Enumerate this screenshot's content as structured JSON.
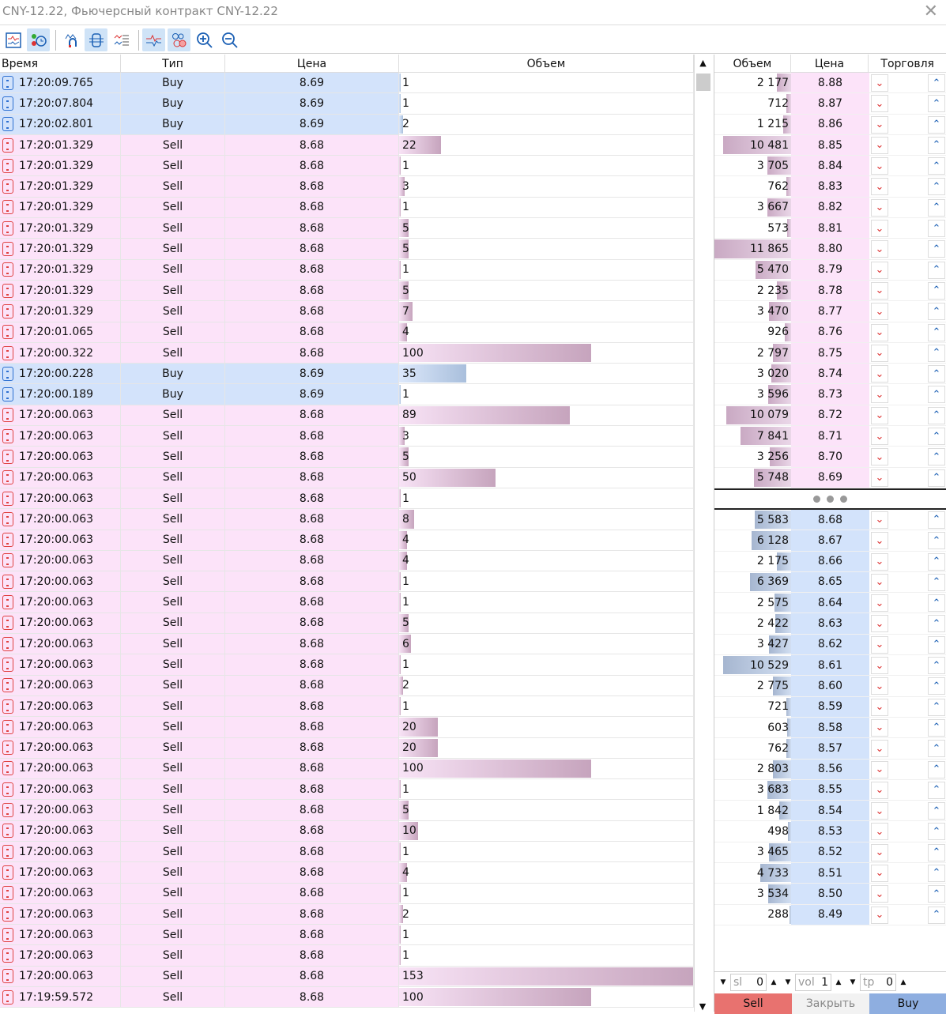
{
  "window": {
    "title": "CNY-12.22, Фьючерсный контракт CNY-12.22"
  },
  "toolbar": [
    "chart-icon",
    "ticks-time-icon",
    "undo-magnet-icon",
    "fit-icon",
    "list-icon",
    "trend-icon",
    "bubbles-icon",
    "zoom-in-icon",
    "zoom-out-icon"
  ],
  "trades": {
    "headers": {
      "time": "Время",
      "type": "Тип",
      "price": "Цена",
      "volume": "Объем"
    },
    "rows": [
      [
        "17:20:09.765",
        "Buy",
        "8.69",
        "1"
      ],
      [
        "17:20:07.804",
        "Buy",
        "8.69",
        "1"
      ],
      [
        "17:20:02.801",
        "Buy",
        "8.69",
        "2"
      ],
      [
        "17:20:01.329",
        "Sell",
        "8.68",
        "22"
      ],
      [
        "17:20:01.329",
        "Sell",
        "8.68",
        "1"
      ],
      [
        "17:20:01.329",
        "Sell",
        "8.68",
        "3"
      ],
      [
        "17:20:01.329",
        "Sell",
        "8.68",
        "1"
      ],
      [
        "17:20:01.329",
        "Sell",
        "8.68",
        "5"
      ],
      [
        "17:20:01.329",
        "Sell",
        "8.68",
        "5"
      ],
      [
        "17:20:01.329",
        "Sell",
        "8.68",
        "1"
      ],
      [
        "17:20:01.329",
        "Sell",
        "8.68",
        "5"
      ],
      [
        "17:20:01.329",
        "Sell",
        "8.68",
        "7"
      ],
      [
        "17:20:01.065",
        "Sell",
        "8.68",
        "4"
      ],
      [
        "17:20:00.322",
        "Sell",
        "8.68",
        "100"
      ],
      [
        "17:20:00.228",
        "Buy",
        "8.69",
        "35"
      ],
      [
        "17:20:00.189",
        "Buy",
        "8.69",
        "1"
      ],
      [
        "17:20:00.063",
        "Sell",
        "8.68",
        "89"
      ],
      [
        "17:20:00.063",
        "Sell",
        "8.68",
        "3"
      ],
      [
        "17:20:00.063",
        "Sell",
        "8.68",
        "5"
      ],
      [
        "17:20:00.063",
        "Sell",
        "8.68",
        "50"
      ],
      [
        "17:20:00.063",
        "Sell",
        "8.68",
        "1"
      ],
      [
        "17:20:00.063",
        "Sell",
        "8.68",
        "8"
      ],
      [
        "17:20:00.063",
        "Sell",
        "8.68",
        "4"
      ],
      [
        "17:20:00.063",
        "Sell",
        "8.68",
        "4"
      ],
      [
        "17:20:00.063",
        "Sell",
        "8.68",
        "1"
      ],
      [
        "17:20:00.063",
        "Sell",
        "8.68",
        "1"
      ],
      [
        "17:20:00.063",
        "Sell",
        "8.68",
        "5"
      ],
      [
        "17:20:00.063",
        "Sell",
        "8.68",
        "6"
      ],
      [
        "17:20:00.063",
        "Sell",
        "8.68",
        "1"
      ],
      [
        "17:20:00.063",
        "Sell",
        "8.68",
        "2"
      ],
      [
        "17:20:00.063",
        "Sell",
        "8.68",
        "1"
      ],
      [
        "17:20:00.063",
        "Sell",
        "8.68",
        "20"
      ],
      [
        "17:20:00.063",
        "Sell",
        "8.68",
        "20"
      ],
      [
        "17:20:00.063",
        "Sell",
        "8.68",
        "100"
      ],
      [
        "17:20:00.063",
        "Sell",
        "8.68",
        "1"
      ],
      [
        "17:20:00.063",
        "Sell",
        "8.68",
        "5"
      ],
      [
        "17:20:00.063",
        "Sell",
        "8.68",
        "10"
      ],
      [
        "17:20:00.063",
        "Sell",
        "8.68",
        "1"
      ],
      [
        "17:20:00.063",
        "Sell",
        "8.68",
        "4"
      ],
      [
        "17:20:00.063",
        "Sell",
        "8.68",
        "1"
      ],
      [
        "17:20:00.063",
        "Sell",
        "8.68",
        "2"
      ],
      [
        "17:20:00.063",
        "Sell",
        "8.68",
        "1"
      ],
      [
        "17:20:00.063",
        "Sell",
        "8.68",
        "1"
      ],
      [
        "17:20:00.063",
        "Sell",
        "8.68",
        "153"
      ],
      [
        "17:19:59.572",
        "Sell",
        "8.68",
        "100"
      ]
    ]
  },
  "book": {
    "headers": {
      "volume": "Объем",
      "price": "Цена",
      "trade": "Торговля"
    },
    "asks": [
      [
        "2 177",
        "8.88"
      ],
      [
        "712",
        "8.87"
      ],
      [
        "1 215",
        "8.86"
      ],
      [
        "10 481",
        "8.85"
      ],
      [
        "3 705",
        "8.84"
      ],
      [
        "762",
        "8.83"
      ],
      [
        "3 667",
        "8.82"
      ],
      [
        "573",
        "8.81"
      ],
      [
        "11 865",
        "8.80"
      ],
      [
        "5 470",
        "8.79"
      ],
      [
        "2 235",
        "8.78"
      ],
      [
        "3 470",
        "8.77"
      ],
      [
        "926",
        "8.76"
      ],
      [
        "2 797",
        "8.75"
      ],
      [
        "3 020",
        "8.74"
      ],
      [
        "3 596",
        "8.73"
      ],
      [
        "10 079",
        "8.72"
      ],
      [
        "7 841",
        "8.71"
      ],
      [
        "3 256",
        "8.70"
      ],
      [
        "5 748",
        "8.69"
      ]
    ],
    "bids": [
      [
        "5 583",
        "8.68"
      ],
      [
        "6 128",
        "8.67"
      ],
      [
        "2 175",
        "8.66"
      ],
      [
        "6 369",
        "8.65"
      ],
      [
        "2 575",
        "8.64"
      ],
      [
        "2 422",
        "8.63"
      ],
      [
        "3 427",
        "8.62"
      ],
      [
        "10 529",
        "8.61"
      ],
      [
        "2 775",
        "8.60"
      ],
      [
        "721",
        "8.59"
      ],
      [
        "603",
        "8.58"
      ],
      [
        "762",
        "8.57"
      ],
      [
        "2 803",
        "8.56"
      ],
      [
        "3 683",
        "8.55"
      ],
      [
        "1 842",
        "8.54"
      ],
      [
        "498",
        "8.53"
      ],
      [
        "3 465",
        "8.52"
      ],
      [
        "4 733",
        "8.51"
      ],
      [
        "3 534",
        "8.50"
      ],
      [
        "288",
        "8.49"
      ]
    ]
  },
  "controls": {
    "sl_label": "sl",
    "sl_value": "0",
    "vol_label": "vol",
    "vol_value": "1",
    "tp_label": "tp",
    "tp_value": "0"
  },
  "actions": {
    "sell": "Sell",
    "close": "Закрыть",
    "buy": "Buy"
  }
}
